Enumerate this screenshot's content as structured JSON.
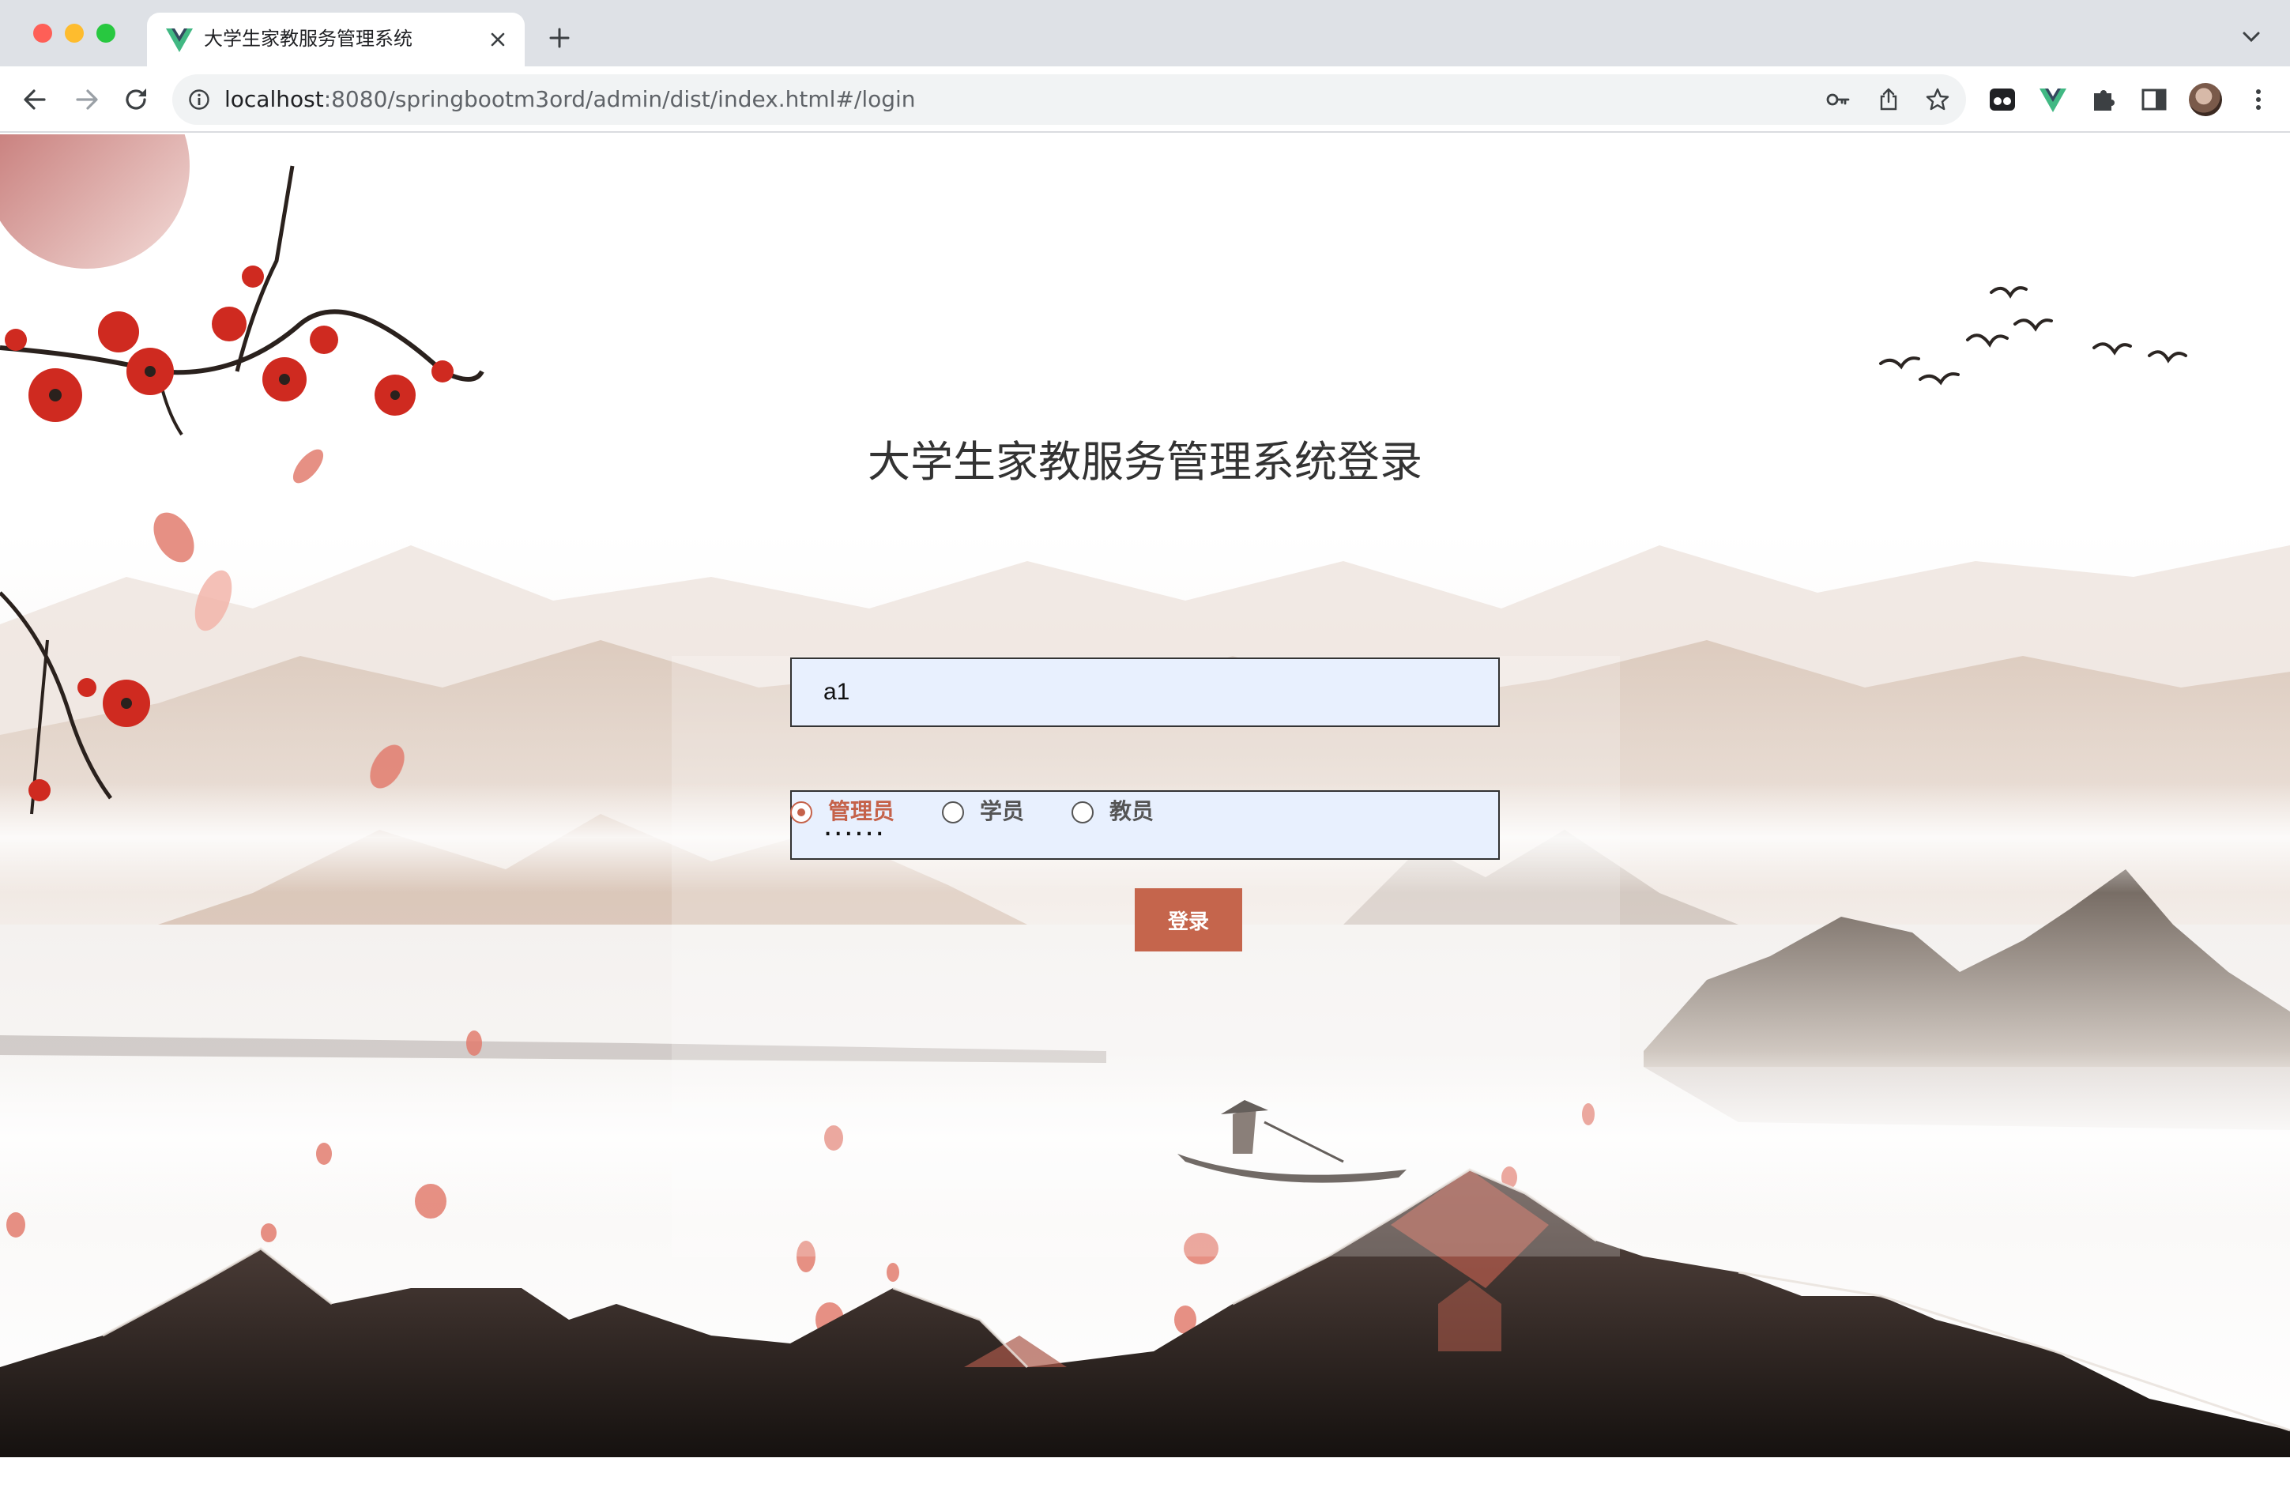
{
  "browser": {
    "tab_title": "大学生家教服务管理系统",
    "url_host": "localhost",
    "url_rest": ":8080/springbootm3ord/admin/dist/index.html#/login"
  },
  "login": {
    "title": "大学生家教服务管理系统登录",
    "username_value": "a1",
    "password_value": "......",
    "roles": [
      "管理员",
      "学员",
      "教员"
    ],
    "selected_role": "管理员",
    "submit_label": "登录"
  },
  "colors": {
    "accent": "#c5654c",
    "field_bg": "#e8f0fe",
    "title": "#333333"
  },
  "icons": [
    "vue-icon",
    "close-icon",
    "plus-icon",
    "chevron-down-icon",
    "back-icon",
    "forward-icon",
    "reload-icon",
    "info-icon",
    "key-icon",
    "share-icon",
    "star-icon",
    "extension-icon",
    "puzzle-icon",
    "sidepanel-icon",
    "profile-avatar",
    "more-vert-icon"
  ]
}
